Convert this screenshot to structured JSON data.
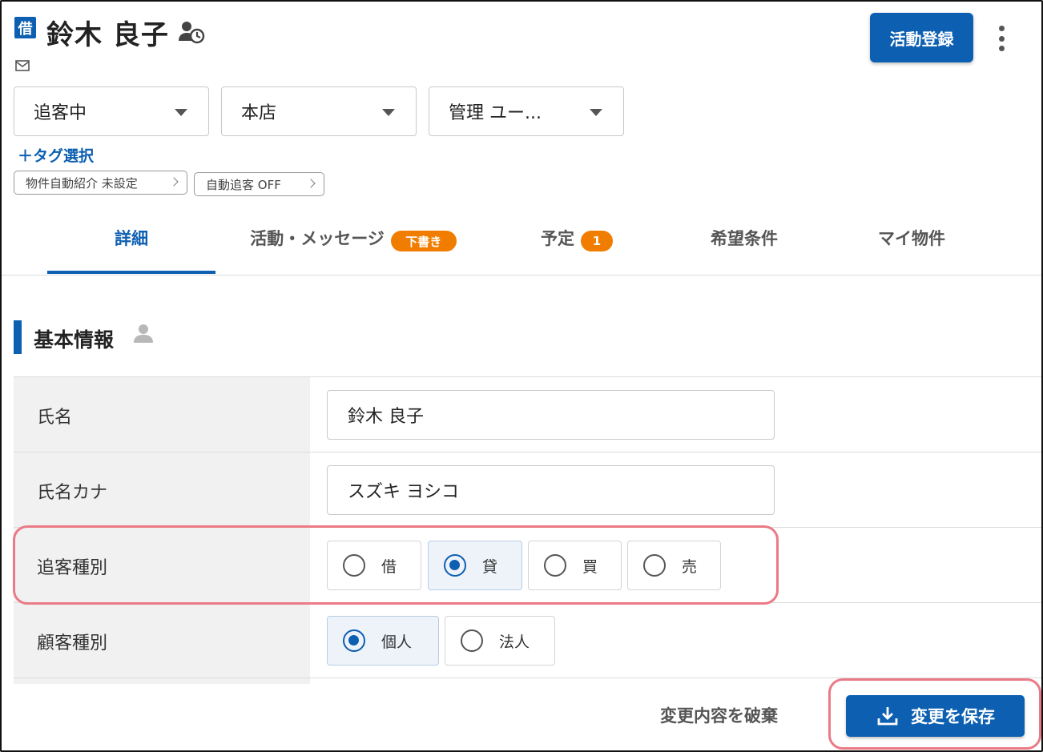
{
  "header": {
    "type_badge": "借",
    "customer_name": "鈴木 良子",
    "activity_button": "活動登録"
  },
  "selects": {
    "status": "追客中",
    "store": "本店",
    "manager": "管理 ユー..."
  },
  "tags": {
    "add_label": "＋タグ選択",
    "chip_auto_intro": "物件自動紹介 未設定",
    "chip_auto_follow": "自動追客 OFF"
  },
  "tabs": [
    {
      "label": "詳細"
    },
    {
      "label": "活動・メッセージ",
      "badge": "下書き"
    },
    {
      "label": "予定",
      "badge": "1"
    },
    {
      "label": "希望条件"
    },
    {
      "label": "マイ物件"
    }
  ],
  "section": {
    "title": "基本情報"
  },
  "form": {
    "name_label": "氏名",
    "name_value": "鈴木 良子",
    "kana_label": "氏名カナ",
    "kana_value": "スズキ ヨシコ",
    "follow_type_label": "追客種別",
    "follow_type_options": [
      "借",
      "貸",
      "買",
      "売"
    ],
    "follow_type_selected": "貸",
    "customer_type_label": "顧客種別",
    "customer_type_options": [
      "個人",
      "法人"
    ],
    "customer_type_selected": "個人"
  },
  "footer": {
    "discard_label": "変更内容を破棄",
    "save_label": "変更を保存"
  },
  "colors": {
    "primary": "#0d5fb1",
    "badge_orange": "#f07d00",
    "highlight": "#ea7a85"
  }
}
